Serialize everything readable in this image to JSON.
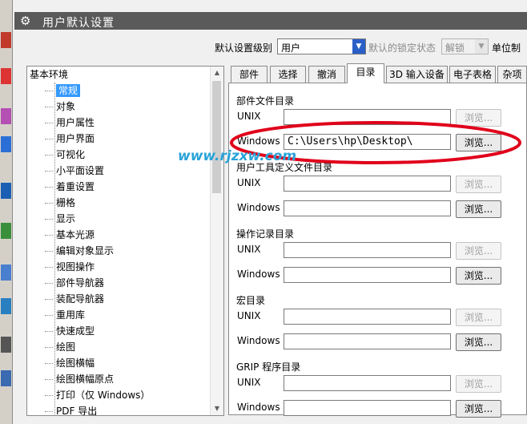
{
  "window": {
    "title": "用户默认设置"
  },
  "top_row": {
    "level_label": "默认设置级别",
    "level_value": "用户",
    "lock_label": "默认的锁定状态",
    "lock_value": "解锁",
    "units_label": "单位制"
  },
  "tree": {
    "root": "基本环境",
    "items": [
      "常规",
      "对象",
      "用户属性",
      "用户界面",
      "可视化",
      "小平面设置",
      "着重设置",
      "栅格",
      "显示",
      "基本光源",
      "编辑对象显示",
      "视图操作",
      "部件导航器",
      "装配导航器",
      "重用库",
      "快速成型",
      "绘图",
      "绘图横幅",
      "绘图横幅原点",
      "打印（仅 Windows）",
      "PDF 导出"
    ],
    "selected_index": 0
  },
  "tabs": [
    "部件",
    "选择",
    "撤消",
    "目录",
    "3D 输入设备",
    "电子表格",
    "杂项"
  ],
  "active_tab_index": 3,
  "sections": [
    {
      "title": "部件文件目录",
      "unix_label": "UNIX",
      "unix_value": "",
      "windows_label": "Windows",
      "windows_value": "C:\\Users\\hp\\Desktop\\"
    },
    {
      "title": "用户工具定义文件目录",
      "unix_label": "UNIX",
      "unix_value": "",
      "windows_label": "Windows",
      "windows_value": ""
    },
    {
      "title": "操作记录目录",
      "unix_label": "UNIX",
      "unix_value": "",
      "windows_label": "Windows",
      "windows_value": ""
    },
    {
      "title": "宏目录",
      "unix_label": "UNIX",
      "unix_value": "",
      "windows_label": "Windows",
      "windows_value": ""
    },
    {
      "title": "GRIP 程序目录",
      "unix_label": "UNIX",
      "unix_value": "",
      "windows_label": "Windows",
      "windows_value": ""
    }
  ],
  "browse_label": "浏览...",
  "watermark": "www.rjzxw.com",
  "colors": {
    "annotation": "#e0001a",
    "selection": "#3399ff",
    "titlebar": "#5a5a5a",
    "watermark": "#2aa3d8"
  }
}
